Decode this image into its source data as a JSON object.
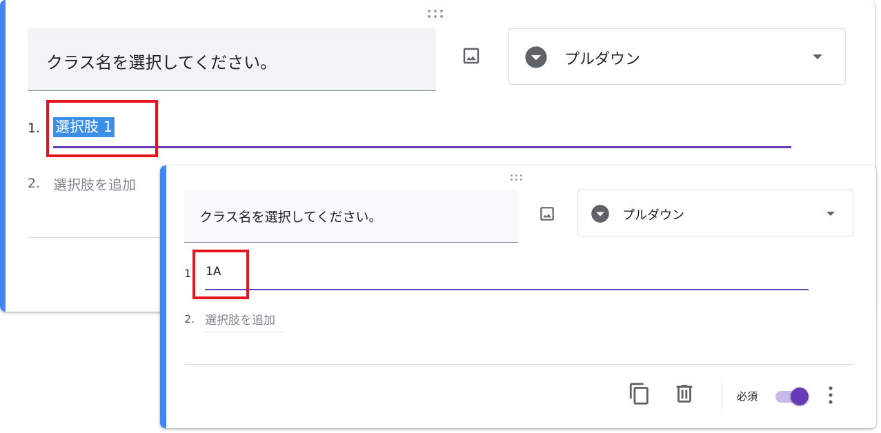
{
  "back_card": {
    "question_title": "クラス名を選択してください。",
    "question_type": "プルダウン",
    "option_1_number": "1.",
    "option_1_text": "選択肢 1",
    "option_2_number": "2.",
    "option_2_text": "選択肢を追加"
  },
  "front_card": {
    "question_title": "クラス名を選択してください。",
    "question_type": "プルダウン",
    "option_1_number": "1",
    "option_1_text": "1A",
    "option_2_number": "2.",
    "option_2_text": "選択肢を追加",
    "required_label": "必須",
    "required_on": true
  },
  "icons": {
    "drag": "drag-handle-icon",
    "image": "image-icon",
    "type": "dropdown-circle-icon",
    "arrow": "caret-down-icon",
    "copy": "copy-icon",
    "delete": "trash-icon",
    "more": "more-vert-icon"
  },
  "colors": {
    "accent_blue": "#4285f4",
    "purple": "#673ab7",
    "highlight_red": "#e8141d",
    "selection_blue": "#3b8ee8"
  }
}
